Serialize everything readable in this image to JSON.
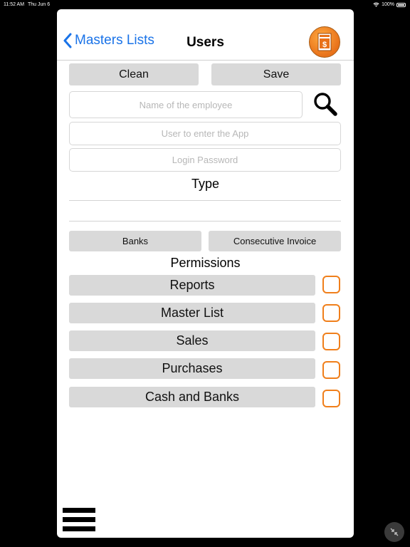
{
  "status_bar": {
    "time": "11:52 AM",
    "date": "Thu Jun 6",
    "battery": "100%"
  },
  "nav": {
    "back_label": "Masters Lists",
    "title": "Users"
  },
  "actions": {
    "clean_label": "Clean",
    "save_label": "Save"
  },
  "form": {
    "employee_placeholder": "Name of the employee",
    "user_placeholder": "User to enter the App",
    "password_placeholder": "Login Password",
    "type_label": "Type"
  },
  "options": {
    "banks_label": "Banks",
    "invoice_label": "Consecutive Invoice"
  },
  "permissions": {
    "title": "Permissions",
    "items": [
      {
        "label": "Reports"
      },
      {
        "label": "Master List"
      },
      {
        "label": "Sales"
      },
      {
        "label": "Purchases"
      },
      {
        "label": "Cash and Banks"
      }
    ]
  },
  "colors": {
    "accent": "#1a73e8",
    "checkbox_border": "#f07f1b",
    "button_bg": "#d9d9d9"
  }
}
